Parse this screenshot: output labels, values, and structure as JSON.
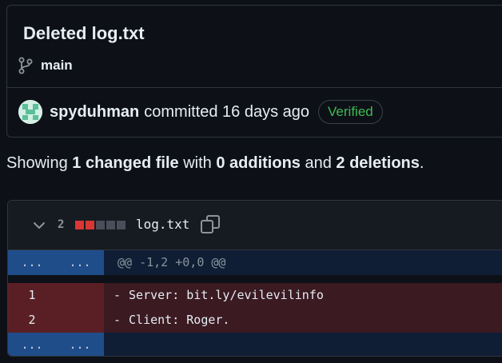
{
  "commit": {
    "title": "Deleted log.txt",
    "branch": "main",
    "author": "spyduhman",
    "action_text": "committed 16 days ago",
    "verified_label": "Verified"
  },
  "summary": {
    "prefix": "Showing ",
    "files": "1 changed file",
    "with_text": " with ",
    "additions": "0 additions",
    "and_text": " and ",
    "deletions": "2 deletions",
    "end": "."
  },
  "diff": {
    "deletion_count": "2",
    "diffstat": {
      "deleted_blocks": 2,
      "total_blocks": 5
    },
    "file_name": "log.txt",
    "hunk_gutter": "...",
    "hunk_header": "@@ -1,2 +0,0 @@",
    "lines": [
      {
        "old_num": "1",
        "new_num": "",
        "marker": "-",
        "text": "Server: bit.ly/evilevilinfo"
      },
      {
        "old_num": "2",
        "new_num": "",
        "marker": "-",
        "text": "Client: Roger."
      }
    ],
    "footer_gutter": "..."
  },
  "colors": {
    "background": "#0d1117",
    "verified_green": "#3fb950",
    "deletion_red": "#da3633",
    "hunk_blue": "#1f4d8a",
    "deleted_line_bg": "#3b1a22"
  },
  "icons": [
    "git-branch-icon",
    "avatar-identicon",
    "chevron-down-icon",
    "copy-icon"
  ]
}
